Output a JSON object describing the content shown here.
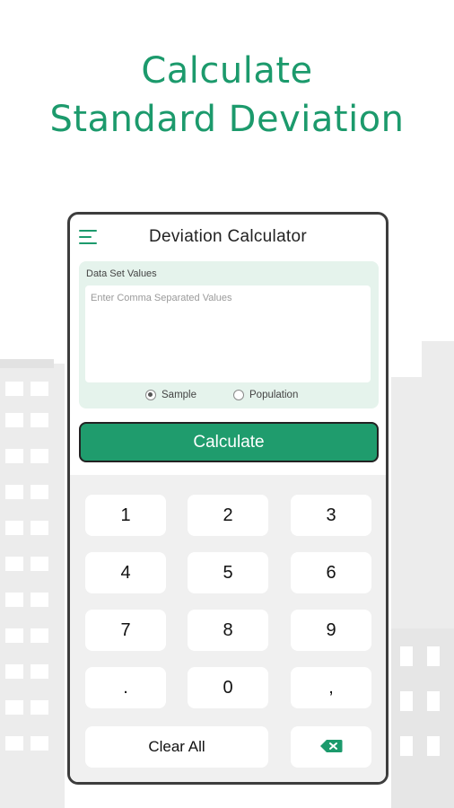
{
  "headline": {
    "line1": "Calculate",
    "line2": "Standard Deviation"
  },
  "app": {
    "title": "Deviation Calculator",
    "menu_icon": "hamburger-menu-icon"
  },
  "input": {
    "label": "Data Set Values",
    "placeholder": "Enter Comma Separated Values",
    "value": ""
  },
  "mode": {
    "options": [
      {
        "label": "Sample",
        "selected": true
      },
      {
        "label": "Population",
        "selected": false
      }
    ]
  },
  "calculate_label": "Calculate",
  "keypad": {
    "keys": [
      "1",
      "2",
      "3",
      "4",
      "5",
      "6",
      "7",
      "8",
      "9",
      ".",
      "0",
      ","
    ],
    "clear_label": "Clear All",
    "backspace_icon": "backspace-icon"
  },
  "colors": {
    "accent": "#1c9a6c",
    "button": "#1f9c6d",
    "card_bg": "#e5f3ec",
    "keypad_bg": "#f0f0f0"
  }
}
